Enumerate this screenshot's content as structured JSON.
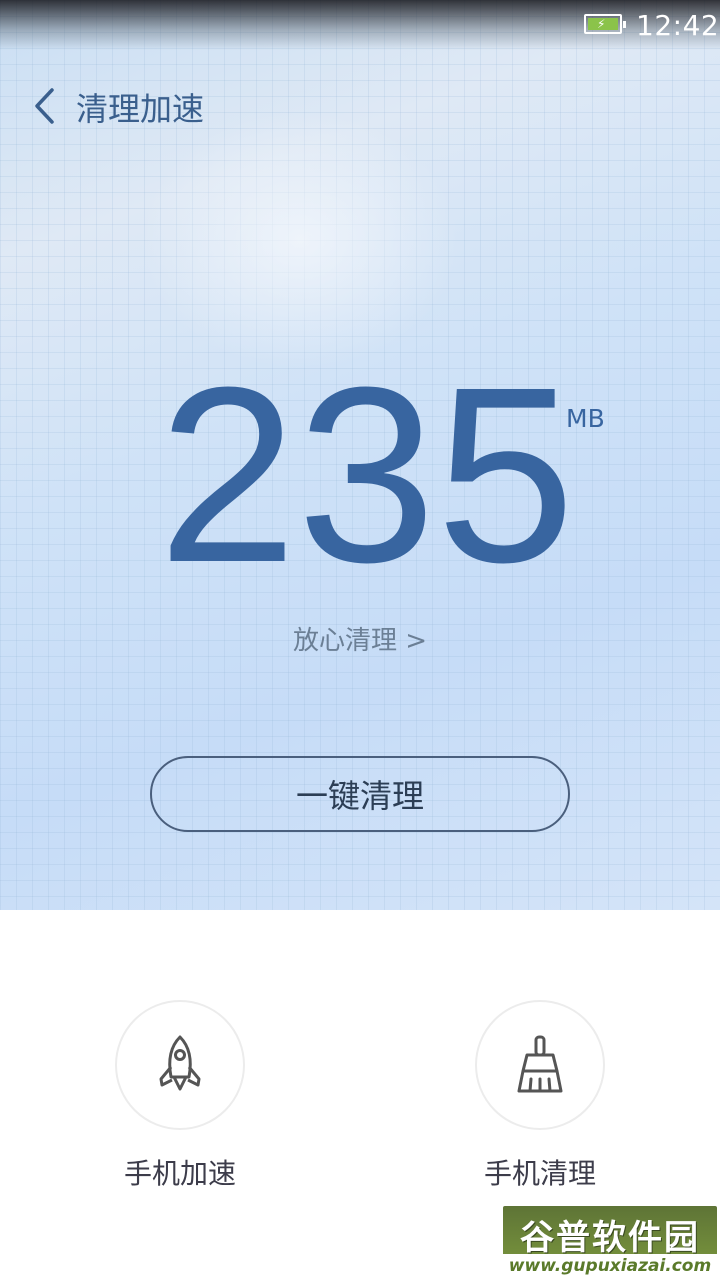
{
  "status_bar": {
    "time": "12:42",
    "battery_icon": "battery-charging-icon"
  },
  "header": {
    "back_icon": "chevron-left-icon",
    "title": "清理加速"
  },
  "summary": {
    "amount": "235",
    "unit": "MB",
    "detail_link": "放心清理 >"
  },
  "primary_action": {
    "label": "一键清理"
  },
  "shortcuts": [
    {
      "icon": "rocket-icon",
      "label": "手机加速"
    },
    {
      "icon": "broom-icon",
      "label": "手机清理"
    }
  ],
  "watermark": {
    "logo_text": "谷普软件园",
    "url": "www.gupuxiazai.com"
  },
  "colors": {
    "accent": "#3865a0",
    "battery": "#8bc34a",
    "watermark_bg": "#6d8a3a"
  }
}
